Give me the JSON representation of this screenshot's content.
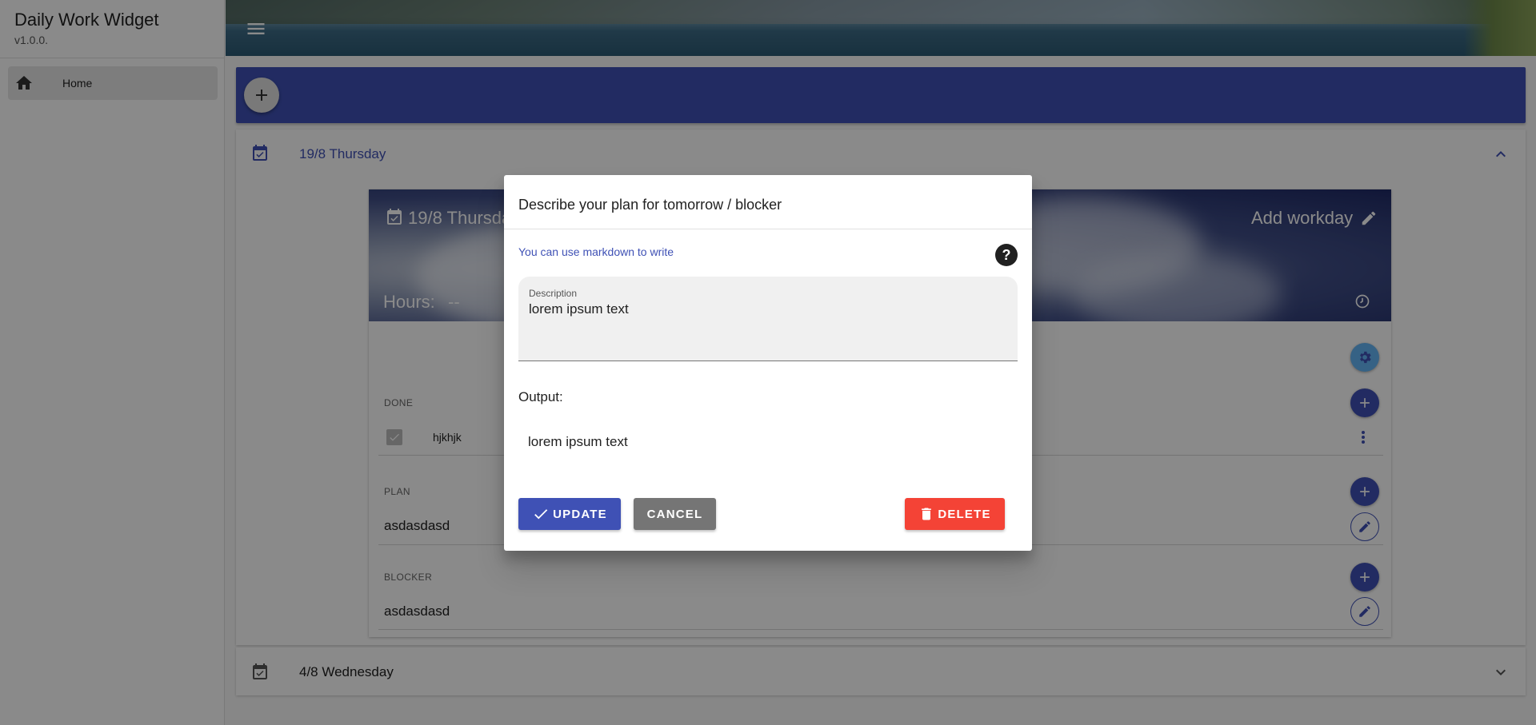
{
  "app": {
    "title": "Daily Work Widget",
    "version": "v1.0.0."
  },
  "sidebar": {
    "items": [
      {
        "label": "Home",
        "icon": "home-icon"
      }
    ]
  },
  "colors": {
    "primary": "#3f51b5",
    "danger": "#f44336",
    "neutral": "#757575"
  },
  "days": [
    {
      "title": "19/8 Thursday",
      "expanded": true,
      "card": {
        "date": "19/8 Thursday",
        "add_workday": "Add workday",
        "hours_label": "Hours:",
        "hours_value": "--",
        "sections": {
          "done": {
            "label": "DONE",
            "items": [
              {
                "text": "hjkhjk",
                "checked": true
              }
            ]
          },
          "plan": {
            "label": "PLAN",
            "text": "asdasdasd"
          },
          "blocker": {
            "label": "BLOCKER",
            "text": "asdasdasd"
          }
        }
      }
    },
    {
      "title": "4/8 Wednesday",
      "expanded": false
    }
  ],
  "dialog": {
    "title": "Describe your plan for tomorrow / blocker",
    "hint": "You can use markdown to write",
    "help": "?",
    "description_label": "Description",
    "description_value": "lorem ipsum text",
    "output_label": "Output:",
    "output_value": "lorem ipsum text",
    "buttons": {
      "update": "UPDATE",
      "cancel": "CANCEL",
      "delete": "DELETE"
    }
  }
}
